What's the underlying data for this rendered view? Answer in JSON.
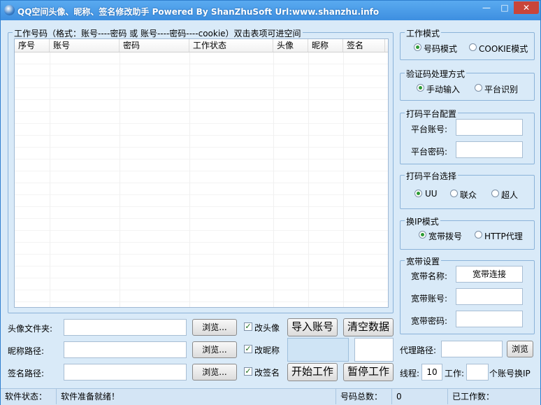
{
  "window": {
    "title": "QQ空间头像、昵称、签名修改助手  Powered By ShanZhuSoft  Url:www.shanzhu.info",
    "min_glyph": "—",
    "max_glyph": "□",
    "close_glyph": "✕"
  },
  "accounts": {
    "group_title": "工作号码（格式：账号----密码 或 账号----密码----cookie）双击表项可进空间",
    "columns": [
      "序号",
      "账号",
      "密码",
      "工作状态",
      "头像",
      "昵称",
      "签名"
    ]
  },
  "bottom": {
    "avatar_folder_label": "头像文件夹:",
    "nickname_path_label": "昵称路径:",
    "signature_path_label": "签名路径:",
    "browse_label": "浏览...",
    "change_avatar_label": "改头像",
    "change_nickname_label": "改昵称",
    "change_signature_label": "改签名",
    "import_label": "导入账号",
    "clear_label": "清空数据",
    "start_label": "开始工作",
    "pause_label": "暂停工作",
    "proxy_label": "代理路径:",
    "proxy_browse_label": "浏览",
    "threads_label": "线程:",
    "threads_value": "10",
    "work_label": "工作:",
    "work_value": "",
    "switch_ip_suffix": "个账号换IP"
  },
  "work_mode": {
    "title": "工作模式",
    "options": [
      "号码模式",
      "COOKIE模式"
    ],
    "selected": 0
  },
  "captcha_mode": {
    "title": "验证码处理方式",
    "options": [
      "手动输入",
      "平台识别"
    ],
    "selected": 0
  },
  "platform_config": {
    "title": "打码平台配置",
    "account_label": "平台账号:",
    "password_label": "平台密码:",
    "account_value": "",
    "password_value": ""
  },
  "platform_select": {
    "title": "打码平台选择",
    "options": [
      "UU",
      "联众",
      "超人"
    ],
    "selected": 0
  },
  "ip_mode": {
    "title": "换IP模式",
    "options": [
      "宽带拨号",
      "HTTP代理"
    ],
    "selected": 0
  },
  "broadband": {
    "title": "宽带设置",
    "name_label": "宽带名称:",
    "name_value": "宽带连接",
    "account_label": "宽带账号:",
    "password_label": "宽带密码:"
  },
  "status": {
    "state_label": "软件状态：",
    "state_value": "软件准备就绪！",
    "total_label": "号码总数：",
    "total_value": "0",
    "worked_label": "已工作数："
  }
}
